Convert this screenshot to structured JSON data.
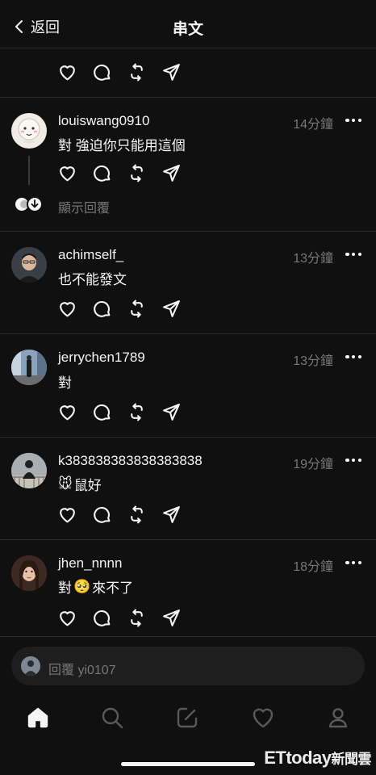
{
  "header": {
    "back_label": "返回",
    "title": "串文"
  },
  "replies": [
    {
      "username": "louiswang0910",
      "time": "14分鐘",
      "text": "對 強迫你只能用這個"
    },
    {
      "username": "achimself_",
      "time": "13分鐘",
      "text": "也不能發文"
    },
    {
      "username": "jerrychen1789",
      "time": "13分鐘",
      "text": "對"
    },
    {
      "username": "k383838383838383838",
      "time": "19分鐘",
      "text_emoji": "🐭",
      "text": "鼠好"
    },
    {
      "username": "jhen_nnnn",
      "time": "18分鐘",
      "text_prefix": "對",
      "text_emoji": "🥺",
      "text": "來不了"
    }
  ],
  "show_replies_label": "顯示回覆",
  "reply_bar": {
    "placeholder": "回覆 yi0107"
  },
  "tabbar": {
    "icons": [
      "home-icon",
      "search-icon",
      "compose-icon",
      "heart-icon",
      "profile-icon"
    ]
  },
  "watermark": {
    "latin": "ETtoday",
    "cn": "新聞雲"
  },
  "colors": {
    "background": "#101010",
    "text": "#f3f5f7",
    "muted": "#777777",
    "inactive_tab": "#5a5a5a"
  }
}
